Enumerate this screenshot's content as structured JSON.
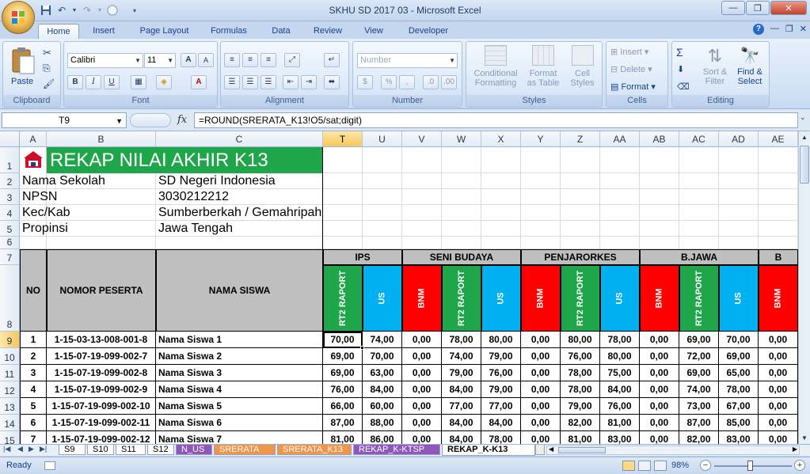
{
  "window": {
    "title": "SKHU SD 2017 03 - Microsoft Excel"
  },
  "ribbon_tabs": [
    "Home",
    "Insert",
    "Page Layout",
    "Formulas",
    "Data",
    "Review",
    "View",
    "Developer"
  ],
  "ribbon": {
    "clipboard": {
      "label": "Clipboard",
      "paste": "Paste"
    },
    "font": {
      "label": "Font",
      "name": "Calibri",
      "size": "11",
      "bold": "B",
      "italic": "I",
      "underline": "U",
      "grow": "A",
      "shrink": "A"
    },
    "alignment": {
      "label": "Alignment"
    },
    "number": {
      "label": "Number",
      "format": "Number",
      "currency": "$",
      "percent": "%"
    },
    "styles": {
      "label": "Styles",
      "cond1": "Conditional",
      "cond2": "Formatting",
      "fmt1": "Format",
      "fmt2": "as Table",
      "cell1": "Cell",
      "cell2": "Styles"
    },
    "cells": {
      "label": "Cells",
      "insert": "Insert",
      "delete": "Delete",
      "format": "Format"
    },
    "editing": {
      "label": "Editing",
      "sort1": "Sort &",
      "sort2": "Filter",
      "find1": "Find &",
      "find2": "Select",
      "sigma": "Σ"
    }
  },
  "formula_bar": {
    "name_box": "T9",
    "fx": "fx",
    "formula": "=ROUND(SRERATA_K13!O5/sat;digit)"
  },
  "columns": [
    "A",
    "B",
    "C",
    "T",
    "U",
    "V",
    "W",
    "X",
    "Y",
    "Z",
    "AA",
    "AB",
    "AC",
    "AD",
    "AE"
  ],
  "rows": [
    "1",
    "2",
    "3",
    "4",
    "5",
    "6",
    "7",
    "8",
    "9",
    "10",
    "11",
    "12",
    "13",
    "14",
    "15"
  ],
  "header_banner": {
    "title": "REKAP NILAI AKHIR K13"
  },
  "school_info": [
    {
      "label": "Nama Sekolah",
      "value": "SD Negeri Indonesia"
    },
    {
      "label": "NPSN",
      "value": "3030212212"
    },
    {
      "label": "Kec/Kab",
      "value": "Sumberberkah / Gemahripah"
    },
    {
      "label": "Propinsi",
      "value": "Jawa Tengah"
    }
  ],
  "table_headers": {
    "no": "NO",
    "nomor": "NOMOR PESERTA",
    "nama": "NAMA SISWA",
    "groups": [
      "IPS",
      "SENI BUDAYA",
      "PENJARORKES",
      "B.JAWA",
      "B"
    ],
    "sub": [
      "RT2 RAPORT",
      "US",
      "BNM",
      "RT2 RAPORT",
      "US",
      "BNM",
      "RT2 RAPORT",
      "US",
      "BNM",
      "RT2 RAPORT",
      "US",
      "BNM"
    ]
  },
  "students": [
    {
      "no": "1",
      "nomor": "1-15-03-13-008-001-8",
      "nama": "Nama Siswa 1",
      "vals": [
        "70,00",
        "74,00",
        "0,00",
        "78,00",
        "80,00",
        "0,00",
        "80,00",
        "78,00",
        "0,00",
        "69,00",
        "70,00",
        "0,00"
      ]
    },
    {
      "no": "2",
      "nomor": "1-15-07-19-099-002-7",
      "nama": "Nama Siswa 2",
      "vals": [
        "69,00",
        "70,00",
        "0,00",
        "74,00",
        "79,00",
        "0,00",
        "76,00",
        "80,00",
        "0,00",
        "72,00",
        "69,00",
        "0,00"
      ]
    },
    {
      "no": "3",
      "nomor": "1-15-07-19-099-002-8",
      "nama": "Nama Siswa 3",
      "vals": [
        "69,00",
        "63,00",
        "0,00",
        "79,00",
        "76,00",
        "0,00",
        "78,00",
        "75,00",
        "0,00",
        "69,00",
        "65,00",
        "0,00"
      ]
    },
    {
      "no": "4",
      "nomor": "1-15-07-19-099-002-9",
      "nama": "Nama Siswa 4",
      "vals": [
        "76,00",
        "84,00",
        "0,00",
        "84,00",
        "79,00",
        "0,00",
        "78,00",
        "84,00",
        "0,00",
        "74,00",
        "78,00",
        "0,00"
      ]
    },
    {
      "no": "5",
      "nomor": "1-15-07-19-099-002-10",
      "nama": "Nama Siswa 5",
      "vals": [
        "66,00",
        "60,00",
        "0,00",
        "77,00",
        "77,00",
        "0,00",
        "79,00",
        "76,00",
        "0,00",
        "73,00",
        "67,00",
        "0,00"
      ]
    },
    {
      "no": "6",
      "nomor": "1-15-07-19-099-002-11",
      "nama": "Nama Siswa 6",
      "vals": [
        "87,00",
        "88,00",
        "0,00",
        "84,00",
        "84,00",
        "0,00",
        "82,00",
        "81,00",
        "0,00",
        "87,00",
        "85,00",
        "0,00"
      ]
    },
    {
      "no": "7",
      "nomor": "1-15-07-19-099-002-12",
      "nama": "Nama Siswa 7",
      "vals": [
        "81,00",
        "86,00",
        "0,00",
        "84,00",
        "78,00",
        "0,00",
        "81,00",
        "83,00",
        "0,00",
        "82,00",
        "83,00",
        "0,00"
      ]
    }
  ],
  "sheet_tabs": [
    {
      "name": "S9",
      "color": "#ffffff"
    },
    {
      "name": "S10",
      "color": "#ffffff"
    },
    {
      "name": "S11",
      "color": "#ffffff"
    },
    {
      "name": "S12",
      "color": "#ffffff"
    },
    {
      "name": "N_US",
      "color": "#8e57b8"
    },
    {
      "name": "SRERATA",
      "color": "#f0954a"
    },
    {
      "name": "SRERATA_K13",
      "color": "#f0954a"
    },
    {
      "name": "REKAP_K-KTSP",
      "color": "#8e57b8"
    },
    {
      "name": "REKAP_K-K13",
      "color": "#ffffff"
    }
  ],
  "status": {
    "ready": "Ready",
    "zoom": "98%"
  },
  "colors": {
    "green": "#1fa64a",
    "red": "#ff0000",
    "blue": "#00b0f0",
    "header_gray": "#bfbfbf"
  }
}
